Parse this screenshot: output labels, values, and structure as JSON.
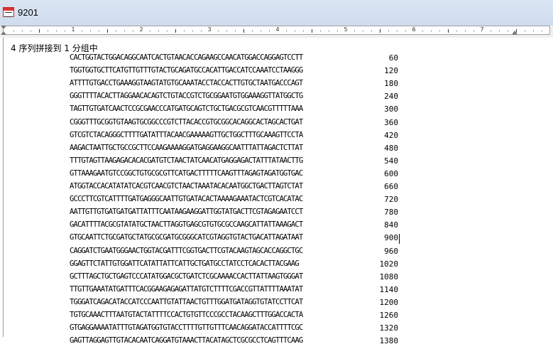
{
  "window": {
    "title": "9201"
  },
  "ruler": {
    "numbers": [
      "1",
      "2",
      "3",
      "4",
      "5",
      "6",
      "7"
    ]
  },
  "document": {
    "heading": "4 序列拼接到 1 分组中",
    "rows": [
      {
        "seq": "CACTGGTACTGGACAGGCAATCACTGTAACACCAGAAGCCAACATGGACCAGGAGTCCTT",
        "num": "60"
      },
      {
        "seq": "TGGTGGTGCTTCATGTTGTTTGTACTGCAGATGCCACATTGACCATCCAAATCCTAAGGG",
        "num": "120"
      },
      {
        "seq": "ATTTTGTGACCTGAAAGGTAAGTATGTGCAAATACCTACCACTTGTGCTAATGACCCAGT",
        "num": "180"
      },
      {
        "seq": "GGGTTTTACACTTAGGAACACAGTCTGTACCGTCTGCGGAATGTGGAAAGGTTATGGCTG",
        "num": "240"
      },
      {
        "seq": "TAGTTGTGATCAACTCCGCGAACCCATGATGCAGTCTGCTGACGCGTCAACGTTTTTAAA",
        "num": "300"
      },
      {
        "seq": "CGGGTTTGCGGTGTAAGTGCGGCCCGTCTTACACCGTGCGGCACAGGCACTAGCACTGAT",
        "num": "360"
      },
      {
        "seq": "GTCGTCTACAGGGCTTTTGATATTTACAACGAAAAAGTTGCTGGCTTTGCAAAGTTCCTA",
        "num": "420"
      },
      {
        "seq": "AAGACTAATTGCTGCCGCTTCCAAGAAAAGGATGAGGAAGGCAATTTATTAGACTCTTAT",
        "num": "480"
      },
      {
        "seq": "TTTGTAGTTAAGAGACACACGATGTCTAACTATCAACATGAGGAGACTATTTATAACTTG",
        "num": "540"
      },
      {
        "seq": "GTTAAAGAATGTCCGGCTGTGCGCGTTCATGACTTTTTCAAGTTTAGAGTAGATGGTGAC",
        "num": "600"
      },
      {
        "seq": "ATGGTACCACATATATCACGTCAACGTCTAACTAAATACACAATGGCTGACTTAGTCTAT",
        "num": "660"
      },
      {
        "seq": "GCCCTTCGTCATTTTGATGAGGGCAATTGTGATACACTAAAAGAAATACTCGTCACATAC",
        "num": "720"
      },
      {
        "seq": "AATTGTTGTGATGATGATTATTTCAATAAGAAGGATTGGTATGACTTCGTAGAGAATCCT",
        "num": "780"
      },
      {
        "seq": "GACATTTTACGCGTATATGCTAACTTAGGTGAGCGTGTGCGCCAAGCATTATTAAAGACT",
        "num": "840"
      },
      {
        "seq": "GTGCAATTCTGCGATGCTATGCGCGATGCGGGCATCGTAGGTGTACTGACATTAGATAAT",
        "num": "900"
      },
      {
        "seq": "CAGGATCTGAATGGGAACTGGTACGATTTCGGTGACTTCGTACAAGTAGCACCAGGCTGC",
        "num": "960"
      },
      {
        "seq": "GGAGTTCTATTGTGGATTCATATTATTCATTGCTGATGCCTATCCTCACACTTACGAAG",
        "num": "1020"
      },
      {
        "seq": "GCTTTAGCTGCTGAGTCCCATATGGACGCTGATCTCGCAAAACCACTTATTAAGTGGGAT",
        "num": "1080"
      },
      {
        "seq": "TTGTTGAAATATGATTTCACGGAAGAGAGATTATGTCTTTTCGACCGTTATTTTAAATAT",
        "num": "1140"
      },
      {
        "seq": "TGGGATCAGACATACCATCCCAATTGTATTAACTGTTTGGATGATAGGTGTATCCTTCAT",
        "num": "1200"
      },
      {
        "seq": "TGTGCAAACTTTAATGTACTATTTTCCACTGTGTTCCCGCCTACAAGCTTTGGACCACTA",
        "num": "1260"
      },
      {
        "seq": "GTGAGGAAAATATTTGTAGATGGTGTACCTTTTGTTGTTTCAACAGGATACCATTTTCGC",
        "num": "1320"
      },
      {
        "seq": "GAGTTAGGAGTTGTACACAATCAGGATGTAAACTTACATAGCTCGCGCCTCAGTTTCAAG",
        "num": "1380"
      }
    ]
  }
}
